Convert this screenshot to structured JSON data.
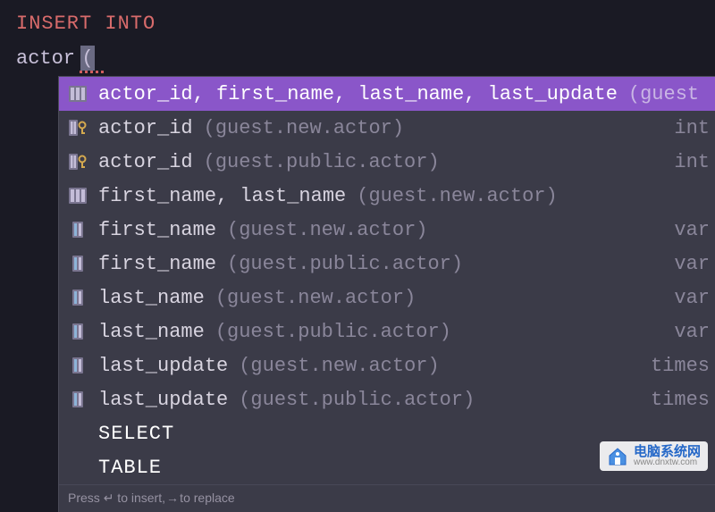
{
  "editor": {
    "line1": "INSERT INTO",
    "line2_token": "actor",
    "line2_paren": "("
  },
  "completion": {
    "hint_prefix": "Press ",
    "hint_enter": "↵",
    "hint_mid": " to insert, ",
    "hint_arrow": "→",
    "hint_end": " to replace",
    "items": [
      {
        "icon": "columns",
        "selected": true,
        "name": "actor_id, first_name, last_name, last_update",
        "source": "(guest",
        "type": ""
      },
      {
        "icon": "key-column",
        "selected": false,
        "name": "actor_id",
        "source": "(guest.new.actor)",
        "type": "int"
      },
      {
        "icon": "key-column",
        "selected": false,
        "name": "actor_id",
        "source": "(guest.public.actor)",
        "type": "int"
      },
      {
        "icon": "columns",
        "selected": false,
        "name": "first_name, last_name",
        "source": "(guest.new.actor)",
        "type": ""
      },
      {
        "icon": "column",
        "selected": false,
        "name": "first_name",
        "source": "(guest.new.actor)",
        "type": "var"
      },
      {
        "icon": "column",
        "selected": false,
        "name": "first_name",
        "source": "(guest.public.actor)",
        "type": "var"
      },
      {
        "icon": "column",
        "selected": false,
        "name": "last_name",
        "source": "(guest.new.actor)",
        "type": "var"
      },
      {
        "icon": "column",
        "selected": false,
        "name": "last_name",
        "source": "(guest.public.actor)",
        "type": "var"
      },
      {
        "icon": "column",
        "selected": false,
        "name": "last_update",
        "source": "(guest.new.actor)",
        "type": "times"
      },
      {
        "icon": "column",
        "selected": false,
        "name": "last_update",
        "source": "(guest.public.actor)",
        "type": "times"
      },
      {
        "icon": "none",
        "selected": false,
        "keyword": true,
        "name": "SELECT",
        "source": "",
        "type": ""
      },
      {
        "icon": "none",
        "selected": false,
        "keyword": true,
        "name": "TABLE",
        "source": "",
        "type": ""
      }
    ]
  },
  "watermark": {
    "cn": "电脑系统网",
    "url": "www.dnxtw.com"
  }
}
